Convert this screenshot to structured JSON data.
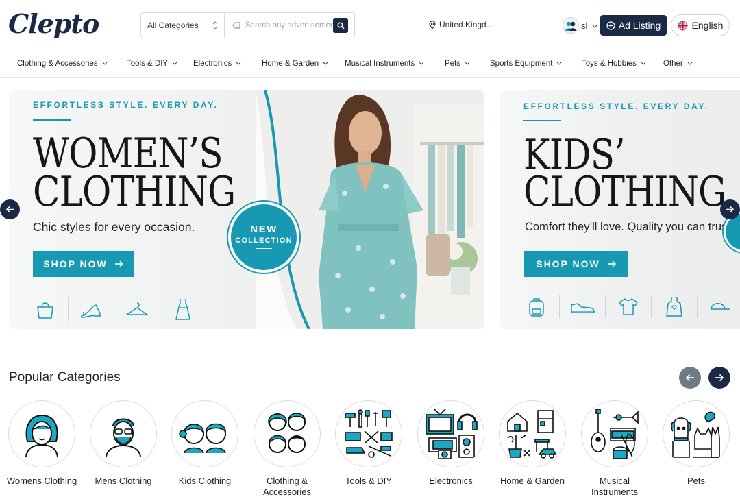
{
  "brand": {
    "logo_text": "Clepto"
  },
  "search": {
    "category": "All Categories",
    "placeholder": "Search any advertisement"
  },
  "location": {
    "label": "United Kingd..."
  },
  "user": {
    "name": "sl"
  },
  "header": {
    "ad_listing_label": "Ad Listing",
    "language_label": "English"
  },
  "nav": {
    "items": [
      {
        "label": "Clothing & Accessories"
      },
      {
        "label": "Tools & DIY"
      },
      {
        "label": "Electronics"
      },
      {
        "label": "Home & Garden"
      },
      {
        "label": "Musical Instruments"
      },
      {
        "label": "Pets"
      },
      {
        "label": "Sports Equipment"
      },
      {
        "label": "Toys & Hobbies"
      },
      {
        "label": "Other"
      }
    ]
  },
  "banners": [
    {
      "eyebrow": "EFFORTLESS STYLE. EVERY DAY.",
      "line1": "WOMEN’S",
      "line2": "CLOTHING",
      "subtitle": "Chic styles for every occasion.",
      "cta": "SHOP NOW",
      "badge_line1": "NEW",
      "badge_line2": "COLLECTION",
      "icons": [
        "handbag-icon",
        "heel-shoe-icon",
        "hanger-icon",
        "dress-icon"
      ]
    },
    {
      "eyebrow": "EFFORTLESS STYLE. EVERY DAY.",
      "line1": "KIDS’",
      "line2": "CLOTHING",
      "subtitle": "Comfort they’ll love. Quality you can trust.",
      "cta": "SHOP NOW",
      "icons": [
        "backpack-icon",
        "sneaker-icon",
        "tshirt-icon",
        "kids-dress-icon",
        "cap-icon"
      ]
    }
  ],
  "popular": {
    "title": "Popular Categories",
    "items": [
      {
        "label": "Womens Clothing"
      },
      {
        "label": "Mens Clothing"
      },
      {
        "label": "Kids Clothing"
      },
      {
        "label": "Clothing & Accessories"
      },
      {
        "label": "Tools & DIY"
      },
      {
        "label": "Electronics"
      },
      {
        "label": "Home & Garden"
      },
      {
        "label": "Musical Instruments"
      },
      {
        "label": "Pets"
      }
    ]
  },
  "colors": {
    "navy": "#1b2a44",
    "teal": "#1899b3"
  }
}
